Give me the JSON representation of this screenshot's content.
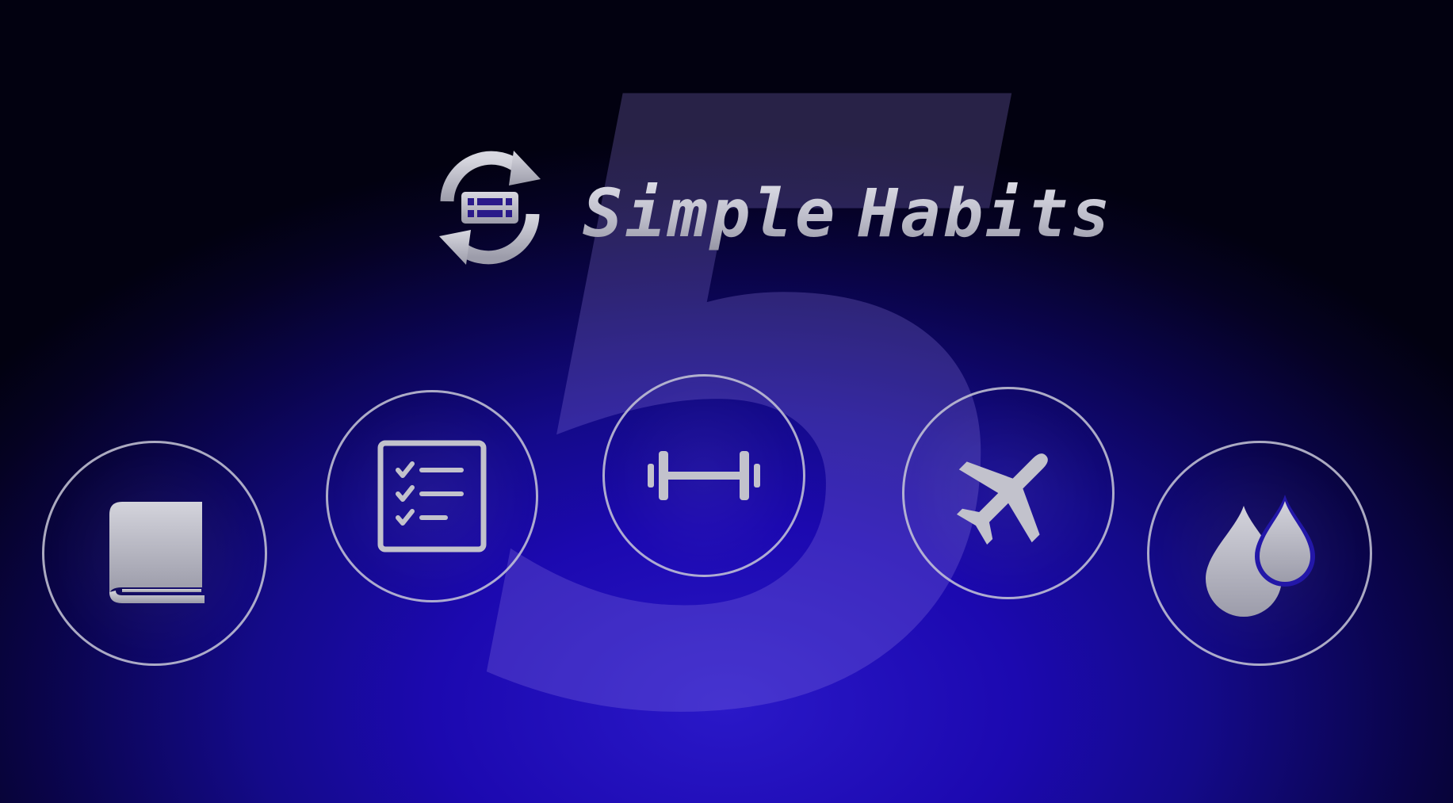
{
  "app": {
    "name_word1": "Simple",
    "name_word2": "Habits",
    "version_number": "5"
  },
  "habits": [
    {
      "icon": "book-icon"
    },
    {
      "icon": "checklist-icon"
    },
    {
      "icon": "dumbbell-icon"
    },
    {
      "icon": "airplane-icon"
    },
    {
      "icon": "water-drops-icon"
    }
  ],
  "colors": {
    "background": "#1c09b0",
    "background_edge": "#020110",
    "icon": "#c2c2cc",
    "ring": "#c8c8d7",
    "numeral": "#9682e6"
  }
}
